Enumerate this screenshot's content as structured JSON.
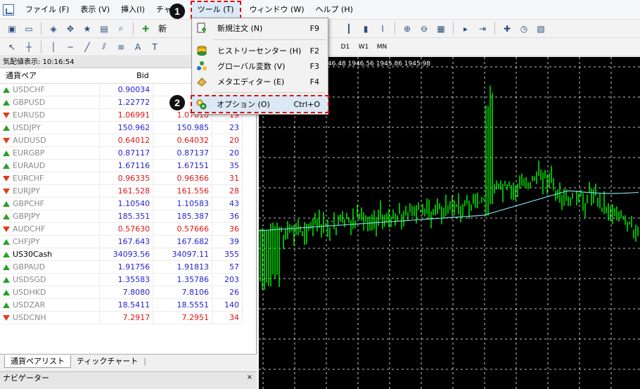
{
  "menubar": {
    "items": [
      "ファイル (F)",
      "表示 (V)",
      "挿入(I)",
      "チャー",
      "ツール (T)",
      "ウィンドウ (W)",
      "ヘルプ (H)"
    ]
  },
  "toolbar2": {
    "timeframes": [
      "D1",
      "W1",
      "MN"
    ],
    "new_order_partial": "新"
  },
  "market_watch": {
    "title": "気配値表示: 10:16:54",
    "close": "×",
    "headers": {
      "symbol": "通貨ペア",
      "bid": "Bid"
    },
    "rows": [
      {
        "symbol": "USDCHF",
        "dir": "up",
        "bid": "0.90034",
        "ask": "0.9",
        "spread": "",
        "bid_color": "blue",
        "sym_color": "grey"
      },
      {
        "symbol": "GBPUSD",
        "dir": "up",
        "bid": "1.22772",
        "ask": "",
        "spread": "",
        "bid_color": "blue",
        "sym_color": "grey"
      },
      {
        "symbol": "EURUSD",
        "dir": "down",
        "bid": "1.06991",
        "ask": "1.07010",
        "spread": "19",
        "bid_color": "red",
        "sym_color": "grey"
      },
      {
        "symbol": "USDJPY",
        "dir": "up",
        "bid": "150.962",
        "ask": "150.985",
        "spread": "23",
        "bid_color": "blue",
        "sym_color": "grey"
      },
      {
        "symbol": "AUDUSD",
        "dir": "down",
        "bid": "0.64012",
        "ask": "0.64032",
        "spread": "20",
        "bid_color": "red",
        "sym_color": "grey"
      },
      {
        "symbol": "EURGBP",
        "dir": "up",
        "bid": "0.87117",
        "ask": "0.87137",
        "spread": "20",
        "bid_color": "blue",
        "sym_color": "grey"
      },
      {
        "symbol": "EURAUD",
        "dir": "up",
        "bid": "1.67116",
        "ask": "1.67151",
        "spread": "35",
        "bid_color": "blue",
        "sym_color": "grey"
      },
      {
        "symbol": "EURCHF",
        "dir": "down",
        "bid": "0.96335",
        "ask": "0.96366",
        "spread": "31",
        "bid_color": "red",
        "sym_color": "grey"
      },
      {
        "symbol": "EURJPY",
        "dir": "down",
        "bid": "161.528",
        "ask": "161.556",
        "spread": "28",
        "bid_color": "red",
        "sym_color": "grey"
      },
      {
        "symbol": "GBPCHF",
        "dir": "up",
        "bid": "1.10540",
        "ask": "1.10583",
        "spread": "43",
        "bid_color": "blue",
        "sym_color": "grey"
      },
      {
        "symbol": "GBPJPY",
        "dir": "up",
        "bid": "185.351",
        "ask": "185.387",
        "spread": "36",
        "bid_color": "blue",
        "sym_color": "grey"
      },
      {
        "symbol": "AUDCHF",
        "dir": "down",
        "bid": "0.57630",
        "ask": "0.57666",
        "spread": "36",
        "bid_color": "red",
        "sym_color": "grey"
      },
      {
        "symbol": "CHFJPY",
        "dir": "up",
        "bid": "167.643",
        "ask": "167.682",
        "spread": "39",
        "bid_color": "blue",
        "sym_color": "grey"
      },
      {
        "symbol": "US30Cash",
        "dir": "up",
        "bid": "34093.56",
        "ask": "34097.11",
        "spread": "355",
        "bid_color": "blue",
        "sym_color": "black"
      },
      {
        "symbol": "GBPAUD",
        "dir": "up",
        "bid": "1.91756",
        "ask": "1.91813",
        "spread": "57",
        "bid_color": "blue",
        "sym_color": "grey"
      },
      {
        "symbol": "USDSGD",
        "dir": "up",
        "bid": "1.35583",
        "ask": "1.35786",
        "spread": "203",
        "bid_color": "blue",
        "sym_color": "grey"
      },
      {
        "symbol": "USDHKD",
        "dir": "up",
        "bid": "7.8080",
        "ask": "7.8106",
        "spread": "26",
        "bid_color": "blue",
        "sym_color": "grey"
      },
      {
        "symbol": "USDZAR",
        "dir": "up",
        "bid": "18.5411",
        "ask": "18.5551",
        "spread": "140",
        "bid_color": "blue",
        "sym_color": "grey"
      },
      {
        "symbol": "USDCNH",
        "dir": "down",
        "bid": "7.2917",
        "ask": "7.2951",
        "spread": "34",
        "bid_color": "red",
        "sym_color": "grey"
      }
    ],
    "tabs": [
      "通貨ペアリスト",
      "ティックチャート"
    ]
  },
  "navigator": {
    "title": "ナビゲーター",
    "close": "×"
  },
  "chart": {
    "header_text": "46.48 1946.56 1945.86 1945.98",
    "bg_color": "#000000",
    "candle_color": "#00ff00",
    "ma_color": "#7fd8e6"
  },
  "tools_menu": {
    "items": [
      {
        "label": "新規注文 (N)",
        "key": "F9",
        "icon": "new-order-icon"
      },
      {
        "label": "ヒストリーセンター (H)",
        "key": "F2",
        "icon": "history-center-icon"
      },
      {
        "label": "グローバル変数 (V)",
        "key": "F3",
        "icon": "global-variables-icon"
      },
      {
        "label": "メタエディター (E)",
        "key": "F4",
        "icon": "meta-editor-icon"
      },
      {
        "label": "オプション (O)",
        "key": "Ctrl+O",
        "icon": "options-icon"
      }
    ]
  },
  "badges": [
    "1",
    "2"
  ],
  "colors": {
    "highlight_outline": "#e01010",
    "bid_blue": "#2323d4",
    "bid_red": "#e01414",
    "up_arrow": "#2aa02a",
    "down_arrow": "#e23b1b"
  }
}
